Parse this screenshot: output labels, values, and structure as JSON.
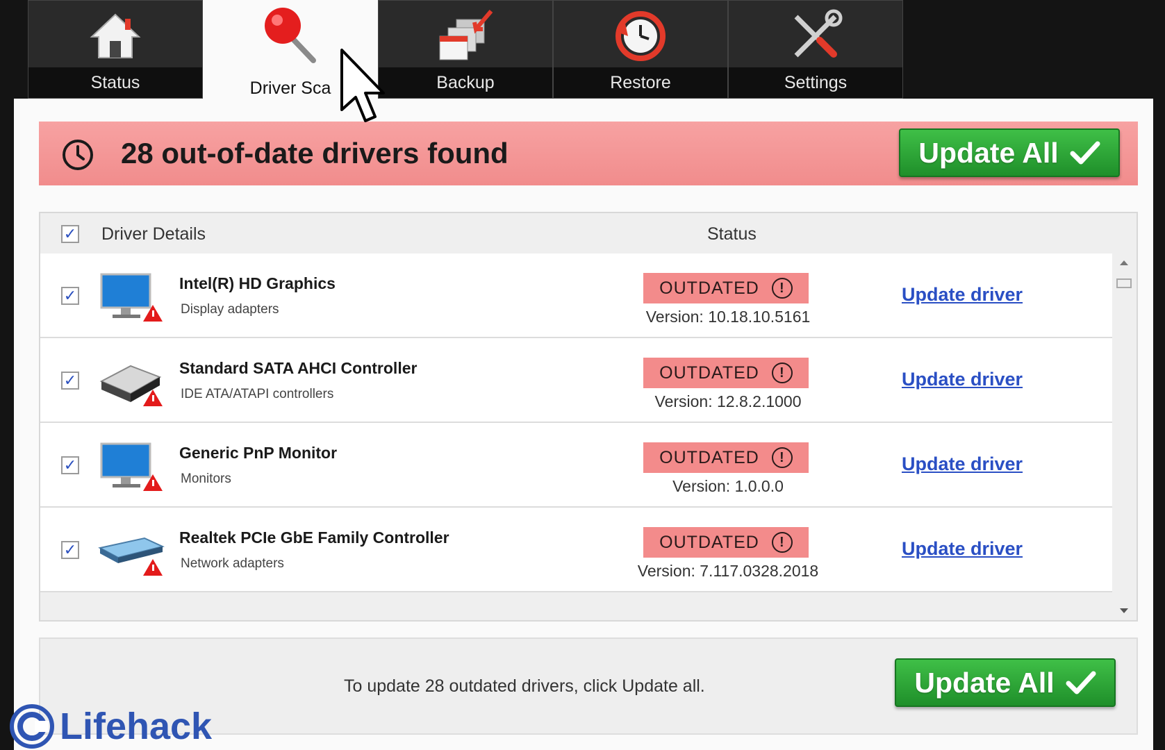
{
  "tabs": [
    {
      "label": "Status",
      "icon": "home-icon"
    },
    {
      "label": "Driver Sca",
      "icon": "magnifier-icon",
      "active": true
    },
    {
      "label": "Backup",
      "icon": "backup-icon"
    },
    {
      "label": "Restore",
      "icon": "restore-clock-icon"
    },
    {
      "label": "Settings",
      "icon": "tools-icon"
    }
  ],
  "banner": {
    "title": "28 out-of-date drivers found",
    "update_all": "Update All"
  },
  "table": {
    "col_details": "Driver Details",
    "col_status": "Status",
    "rows": [
      {
        "name": "Intel(R) HD Graphics",
        "category": "Display adapters",
        "status": "OUTDATED",
        "version": "Version: 10.18.10.5161",
        "action": "Update driver",
        "icon": "monitor-icon"
      },
      {
        "name": "Standard SATA AHCI Controller",
        "category": "IDE ATA/ATAPI controllers",
        "status": "OUTDATED",
        "version": "Version: 12.8.2.1000",
        "action": "Update driver",
        "icon": "hard-drive-icon"
      },
      {
        "name": "Generic PnP Monitor",
        "category": "Monitors",
        "status": "OUTDATED",
        "version": "Version: 1.0.0.0",
        "action": "Update driver",
        "icon": "monitor-icon"
      },
      {
        "name": "Realtek PCIe GbE Family Controller",
        "category": "Network adapters",
        "status": "OUTDATED",
        "version": "Version: 7.117.0328.2018",
        "action": "Update driver",
        "icon": "network-adapter-icon"
      }
    ]
  },
  "footer": {
    "message": "To update 28 outdated drivers, click Update all.",
    "update_all": "Update All"
  },
  "watermark": {
    "text": "Lifehack"
  },
  "colors": {
    "banner": "#f18c8c",
    "button_green": "#2aa336",
    "link_blue": "#2a4fc4",
    "badge_red": "#f38b8b"
  }
}
